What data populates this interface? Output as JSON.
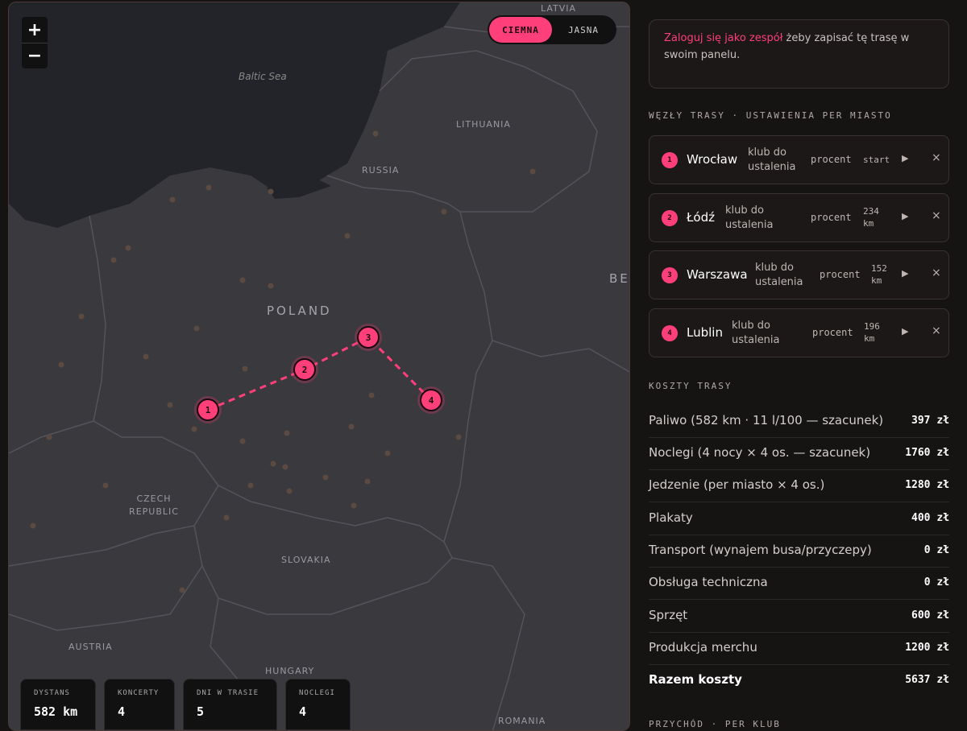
{
  "map": {
    "zoom_in": "+",
    "zoom_out": "−",
    "theme_toggle": {
      "dark": "CIEMNA",
      "light": "JASNA",
      "active": "dark"
    },
    "labels": {
      "latvia": "LATVIA",
      "baltic_sea": "Baltic Sea",
      "lithuania": "LITHUANIA",
      "russia": "RUSSIA",
      "belarus_partial": "BE",
      "poland": "POLAND",
      "czech_line1": "CZECH",
      "czech_line2": "REPUBLIC",
      "slovakia": "SLOVAKIA",
      "austria": "AUSTRIA",
      "hungary": "HUNGARY",
      "romania": "ROMANIA"
    },
    "route_pins": [
      "1",
      "2",
      "3",
      "4"
    ],
    "colors": {
      "accent": "#ff3f7a",
      "land": "#3a393e",
      "water": "#232429"
    }
  },
  "stats": [
    {
      "label": "DYSTANS",
      "value": "582 km"
    },
    {
      "label": "KONCERTY",
      "value": "4"
    },
    {
      "label": "DNI W TRASIE",
      "value": "5"
    },
    {
      "label": "NOCLEGI",
      "value": "4"
    }
  ],
  "panel": {
    "login": {
      "link": "Zaloguj się jako zespół",
      "text": " żeby zapisać tę trasę w swoim panelu."
    },
    "nodes_title": "WĘZŁY TRASY · USTAWIENIA PER MIASTO",
    "nodes": [
      {
        "num": "1",
        "city": "Wrocław",
        "club_line1": "klub do",
        "club_line2": "ustalenia",
        "fee": "procent",
        "dist_line1": "start",
        "dist_line2": ""
      },
      {
        "num": "2",
        "city": "Łódź",
        "club_line1": "klub do",
        "club_line2": "ustalenia",
        "fee": "procent",
        "dist_line1": "234",
        "dist_line2": "km"
      },
      {
        "num": "3",
        "city": "Warszawa",
        "club_line1": "klub do",
        "club_line2": "ustalenia",
        "fee": "procent",
        "dist_line1": "152",
        "dist_line2": "km"
      },
      {
        "num": "4",
        "city": "Lublin",
        "club_line1": "klub do",
        "club_line2": "ustalenia",
        "fee": "procent",
        "dist_line1": "196",
        "dist_line2": "km"
      }
    ],
    "play_icon": "▶",
    "close_icon": "×",
    "costs_title": "KOSZTY TRASY",
    "costs": [
      {
        "name": "Paliwo (582 km · 11 l/100 — szacunek)",
        "amount": "397 zł"
      },
      {
        "name": "Noclegi (4 nocy × 4 os. — szacunek)",
        "amount": "1760 zł"
      },
      {
        "name": "Jedzenie (per miasto × 4 os.)",
        "amount": "1280 zł"
      },
      {
        "name": "Plakaty",
        "amount": "400 zł"
      },
      {
        "name": "Transport (wynajem busa/przyczepy)",
        "amount": "0 zł"
      },
      {
        "name": "Obsługa techniczna",
        "amount": "0 zł"
      },
      {
        "name": "Sprzęt",
        "amount": "600 zł"
      },
      {
        "name": "Produkcja merchu",
        "amount": "1200 zł"
      },
      {
        "name": "Razem koszty",
        "amount": "5637 zł"
      }
    ],
    "revenue_title": "PRZYCHÓD · PER KLUB"
  }
}
